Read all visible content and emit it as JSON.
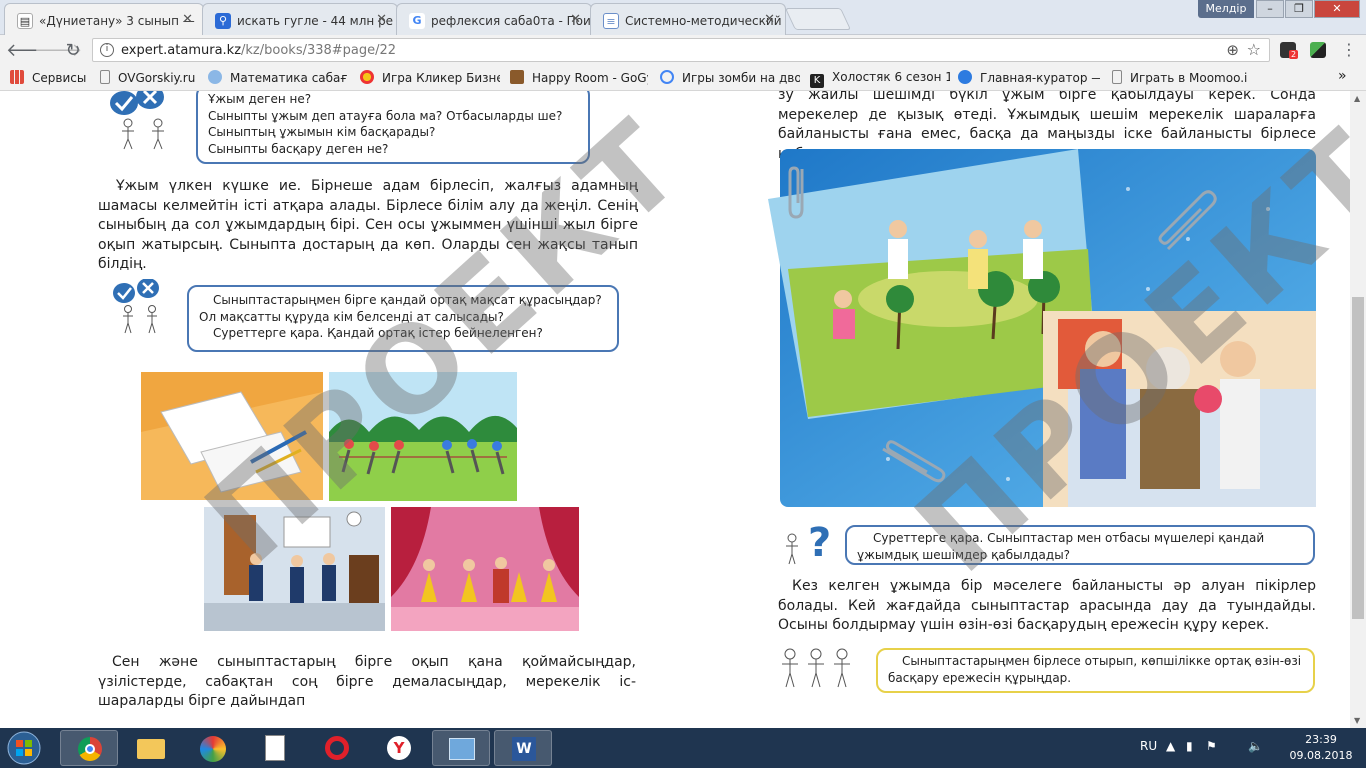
{
  "browser": {
    "tabs": [
      {
        "label": "«Дүниетану» 3 сынып —",
        "icon": "book-icon",
        "active": true
      },
      {
        "label": "искать гугле - 44 млн ре",
        "icon": "search-icon",
        "active": false
      },
      {
        "label": "рефлексия саба0та - Пои",
        "icon": "google-icon",
        "active": false
      },
      {
        "label": "Системно-методический",
        "icon": "doc-icon",
        "active": false
      }
    ],
    "window_user": "Мелдір",
    "window_buttons": [
      "–",
      "❐",
      "✕"
    ],
    "url_host": "expert.atamura.kz",
    "url_path": "/kz/books/338#page/22",
    "ext_badge": "2",
    "bookmarks": [
      {
        "label": "Сервисы",
        "icon": "apps-icon"
      },
      {
        "label": "OVGorskiy.ru",
        "icon": "page-icon"
      },
      {
        "label": "Математика сабағы",
        "icon": "globe-icon"
      },
      {
        "label": "Игра Кликер Бизнес",
        "icon": "game-icon"
      },
      {
        "label": "Happy Room - GoGy",
        "icon": "game-icon"
      },
      {
        "label": "Игры зомби на дво",
        "icon": "google-icon"
      },
      {
        "label": "Холостяк 6 сезон 1-",
        "icon": "k-icon"
      },
      {
        "label": "Главная-куратор —",
        "icon": "globe-icon"
      },
      {
        "label": "Играть в Moomoo.io",
        "icon": "page-icon"
      }
    ],
    "bookmarks_more": "»"
  },
  "page": {
    "left": {
      "q1": [
        "Ұжым деген не?",
        "Сыныпты ұжым деп атауға бола ма? Отбасыларды ше?",
        "Сыныптың ұжымын кім басқарады?",
        "Сыныпты басқару деген не?"
      ],
      "para1": "Ұжым үлкен күшке ие. Бірнеше адам бірлесіп, жалғыз адамның шамасы келмейтін істі атқара алады. Бірлесе білім алу да жеңіл. Сенің сыныбың да сол ұжымдардың бірі. Сен осы ұжыммен үшінші жыл бірге оқып жатырсың. Сыныпта достарың да көп. Оларды сен жақсы танып білдің.",
      "q2": [
        "Сыныптастарыңмен бірге қандай ортақ мақсат құрасыңдар? Ол мақсатты құруда кім белсенді ат салысады?",
        "Суреттерге қара. Қандай ортақ істер бейнеленген?"
      ],
      "para2": "Сен және сыныптастарың бірге оқып қана қоймайсыңдар, үзілістерде, сабақтан соң бірге демаласыңдар, мерекелік іс-шараларды бірге дайындап"
    },
    "right": {
      "para_top": "зу жайлы шешімді бүкіл ұжым бірге қабылдауы керек. Сонда мерекелер де қызық өтеді. Ұжымдық шешім мерекелік шараларға байланысты ғана емес, басқа да маңызды іске байланысты бірлесе қабылдануы керек.",
      "q3": "Суреттерге қара. Сыныптастар мен отбасы мүшелері қандай ұжымдық шешімдер қабылдады?",
      "para3": "Кез келген ұжымда бір мәселеге байланысты әр алуан пікірлер болады. Кей жағдайда сыныптастар арасында дау да туындайды. Осыны болдырмау үшін өзін-өзі басқарудың ережесін құру керек.",
      "task": "Сыныптастарыңмен бірлесе отырып, көпшілікке ортақ өзін-өзі басқару ережесін құрыңдар."
    },
    "watermark": "ПРОЕКТ"
  },
  "taskbar": {
    "apps": [
      "chrome-icon",
      "explorer-icon",
      "paint-icon",
      "notepad-icon",
      "opera-icon",
      "yandex-icon",
      "control-panel-icon",
      "word-icon"
    ],
    "lang": "RU",
    "time": "23:39",
    "date": "09.08.2018"
  }
}
